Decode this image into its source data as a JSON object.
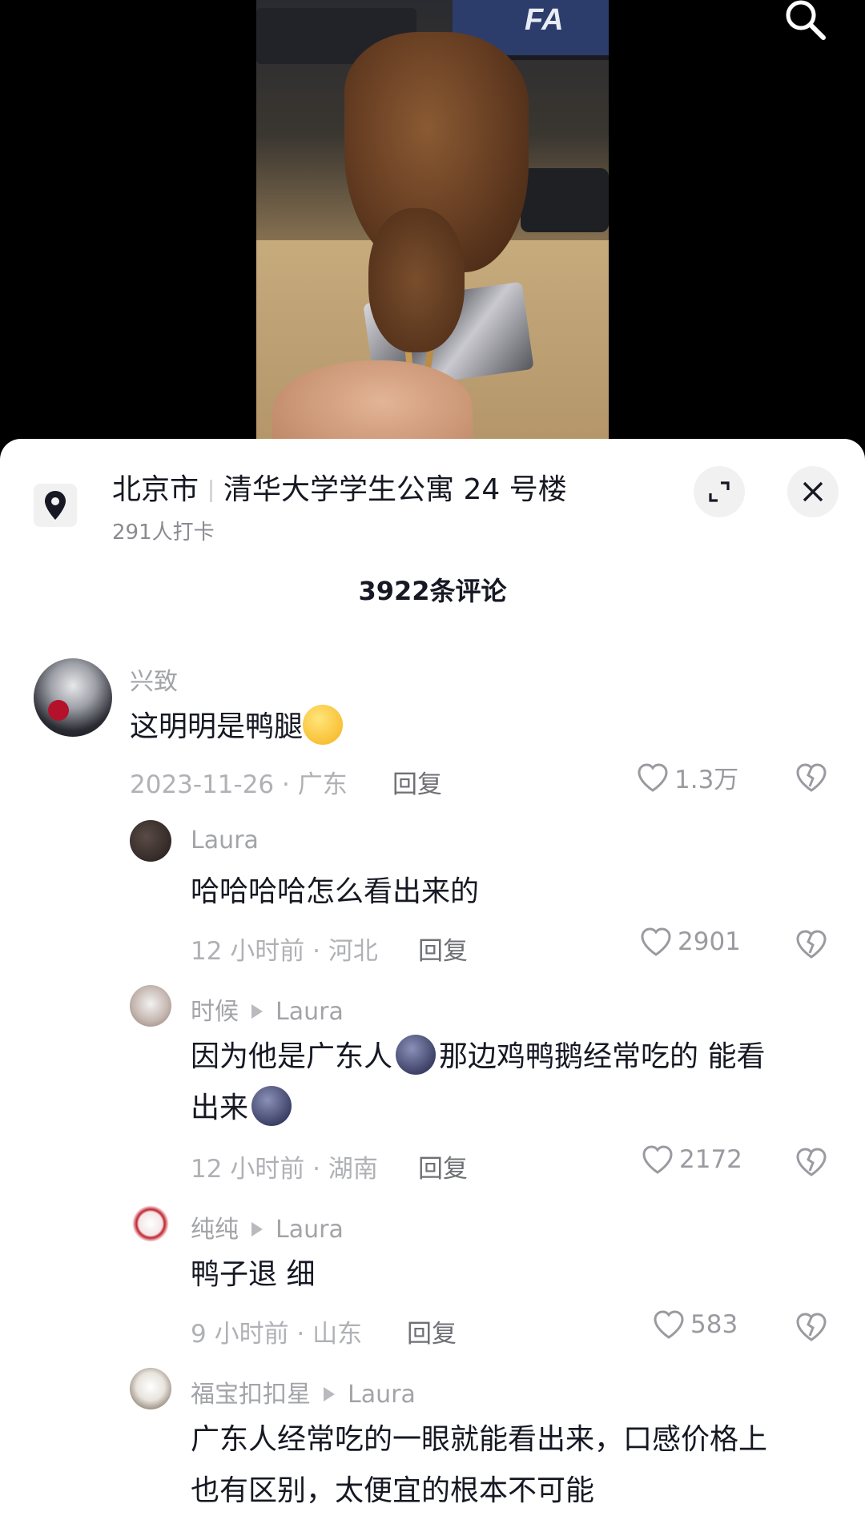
{
  "video": {
    "monitor_text": "FA"
  },
  "location": {
    "city": "北京市",
    "place": "清华大学学生公寓 24 号楼",
    "checkins": "291人打卡"
  },
  "comments_header": {
    "count_label": "3922条评论"
  },
  "comments": [
    {
      "name": "兴致",
      "text": "这明明是鸭腿",
      "meta": "2023-11-26 · 广东",
      "reply": "回复",
      "likes": "1.3万"
    },
    {
      "name": "Laura",
      "text": "哈哈哈哈怎么看出来的",
      "meta": "12 小时前 · 河北",
      "reply": "回复",
      "likes": "2901"
    },
    {
      "name": "时候",
      "reply_to": "Laura",
      "text_a": "因为他是广东人",
      "text_b": "那边鸡鸭鹅经常吃的 能看",
      "text_c": "出来",
      "meta": "12 小时前 · 湖南",
      "reply": "回复",
      "likes": "2172"
    },
    {
      "name": "纯纯",
      "reply_to": "Laura",
      "text": "鸭子退 细",
      "meta": "9 小时前 · 山东",
      "reply": "回复",
      "likes": "583"
    },
    {
      "name": "福宝扣扣星",
      "reply_to": "Laura",
      "text_line1": "广东人经常吃的一眼就能看出来，口感价格上",
      "text_line2": "也有区别，太便宜的根本不可能"
    }
  ],
  "colors": {
    "text": "#161823",
    "muted": "#a3a4a8",
    "sheet_bg": "#ffffff",
    "video_bg": "#000000"
  },
  "icons": [
    "search-icon",
    "location-pin-icon",
    "expand-icon",
    "close-icon",
    "heart-icon",
    "broken-heart-icon",
    "laugh-cry-emoji",
    "moon-face-emoji"
  ]
}
